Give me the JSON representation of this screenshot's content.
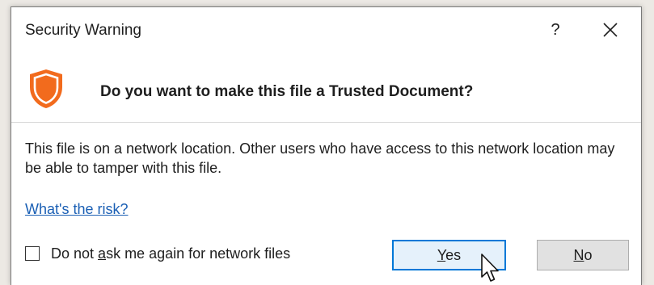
{
  "dialog": {
    "title": "Security Warning",
    "help_label": "?",
    "close_icon": "close-icon",
    "header_icon": "shield-icon",
    "question": "Do you want to make this file a Trusted Document?",
    "message": "This file is on a network location. Other users who have access to this network location may be able to tamper with this file.",
    "risk_link": "What's the risk?",
    "checkbox": {
      "label_before": "Do not ",
      "label_access_key": "a",
      "label_after": "sk me again for network files",
      "checked": false
    },
    "buttons": {
      "yes_access_key": "Y",
      "yes_rest": "es",
      "no_access_key": "N",
      "no_rest": "o"
    }
  },
  "colors": {
    "shield_orange": "#f26b1d",
    "link_blue": "#1a5fb4",
    "focus_border": "#0078d7",
    "yes_bg": "#e5f1fb"
  }
}
